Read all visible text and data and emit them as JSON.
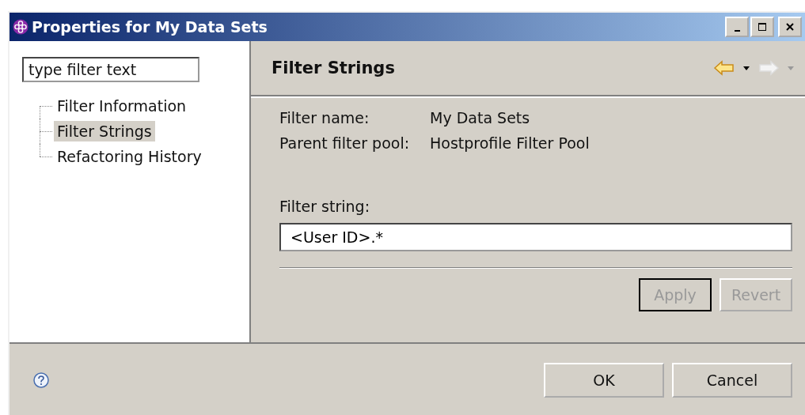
{
  "window": {
    "title": "Properties for My Data Sets"
  },
  "filter": {
    "placeholder": "type filter text"
  },
  "tree": [
    {
      "label": "Filter Information",
      "selected": false
    },
    {
      "label": "Filter Strings",
      "selected": true
    },
    {
      "label": "Refactoring History",
      "selected": false
    }
  ],
  "page": {
    "title": "Filter Strings",
    "properties": [
      {
        "label": "Filter name:",
        "value": "My Data Sets"
      },
      {
        "label": "Parent filter pool:",
        "value": "Hostprofile Filter Pool"
      }
    ],
    "field_label": "Filter string:",
    "field_value": "<User ID>.*",
    "buttons": [
      {
        "label": "Apply",
        "disabled": true,
        "default": true
      },
      {
        "label": "Revert",
        "disabled": true,
        "default": false
      }
    ]
  },
  "nav": {
    "back_disabled": false,
    "forward_disabled": true
  },
  "buttons": [
    "OK",
    "Cancel"
  ]
}
